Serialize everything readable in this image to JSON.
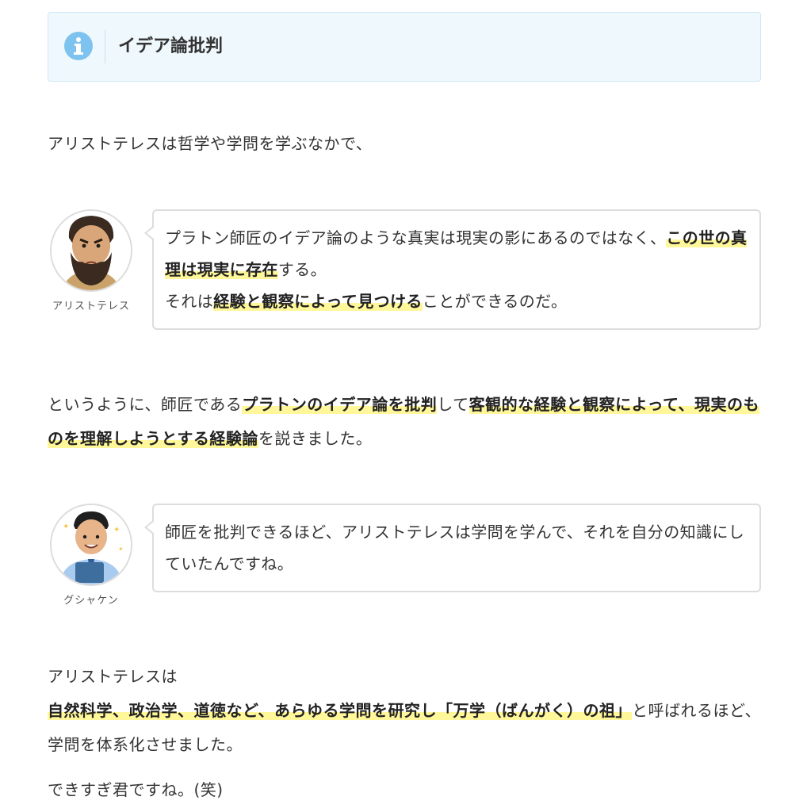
{
  "info_box": {
    "title": "イデア論批判",
    "icon": "info-icon",
    "accent": "#7ec3ef"
  },
  "intro": "アリストテレスは哲学や学問を学ぶなかで、",
  "dialog1": {
    "speaker": "アリストテレス",
    "avatar": "aristotle-avatar",
    "lines": [
      [
        "プラトン師匠のイデア論のような真実は現実の影にあるのではなく、",
        "この世の真理は現実に存在",
        "する。"
      ],
      [
        "それは",
        "経験と観察によって見つける",
        "ことができるのだ。"
      ]
    ]
  },
  "para2": [
    "というように、師匠である",
    "プラトンのイデア論を批判",
    "して",
    "客観的な経験と観察によって、現実のものを理解しようとする経験論",
    "を説きました。"
  ],
  "dialog2": {
    "speaker": "グシャケン",
    "avatar": "gushaken-avatar",
    "text": "師匠を批判できるほど、アリストテレスは学問を学んで、それを自分の知識にしていたんですね。"
  },
  "para3": [
    "アリストテレスは",
    "自然科学、政治学、道徳など、あらゆる学問を研究し「万学（ばんがく）の祖」",
    "と呼ばれるほど、学問を体系化させました。"
  ],
  "para4": "できすぎ君ですね。(笑)",
  "colors": {
    "highlight": "#fff799",
    "text": "#333333",
    "info_bg": "#eff8fd",
    "bubble_border": "#dddddd"
  }
}
